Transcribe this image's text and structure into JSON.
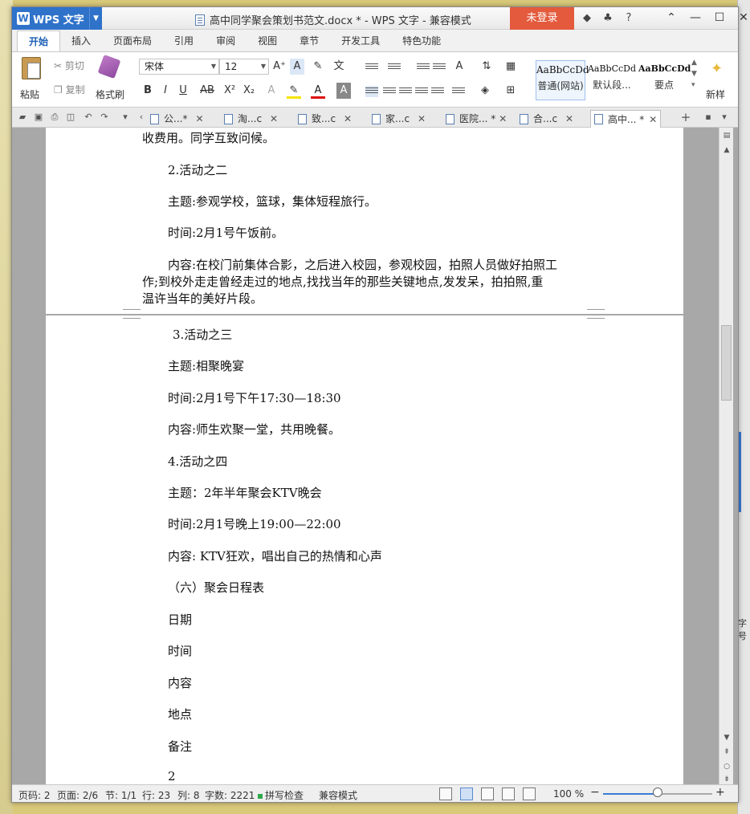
{
  "window": {
    "app_name": "WPS 文字",
    "title": "高中同学聚会策划书范文.docx * - WPS 文字 - 兼容模式",
    "login": "未登录"
  },
  "ribbon_tabs": [
    "开始",
    "插入",
    "页面布局",
    "引用",
    "审阅",
    "视图",
    "章节",
    "开发工具",
    "特色功能"
  ],
  "ribbon": {
    "paste": "粘贴",
    "cut": "剪切",
    "copy": "复制",
    "format_painter": "格式刷",
    "font_name": "宋体",
    "font_size": "12",
    "styles": [
      {
        "sample": "AaBbCcDd",
        "label": "普通(网站)"
      },
      {
        "sample": "AaBbCcDd",
        "label": "默认段..."
      },
      {
        "sample": "AaBbCcDd",
        "label": "要点"
      }
    ],
    "new_style": "新样"
  },
  "doc_tabs": [
    {
      "label": "公...*",
      "active": false
    },
    {
      "label": "淘...c",
      "active": false
    },
    {
      "label": "致...c",
      "active": false
    },
    {
      "label": "家...c",
      "active": false
    },
    {
      "label": "医院... *",
      "active": false
    },
    {
      "label": "合...c",
      "active": false
    },
    {
      "label": "高中... *",
      "active": true
    }
  ],
  "page1_lines": [
    "收费用。同学互致问候。",
    "2.活动之二",
    "主题:参观学校，篮球，集体短程旅行。",
    "时间:2月1号午饭前。",
    "内容:在校门前集体合影，之后进入校园，参观校园，拍照人员做好拍照工",
    "作;到校外走走曾经走过的地点,找找当年的那些关键地点,发发呆，拍拍照,重",
    "温许当年的美好片段。"
  ],
  "page2_lines": [
    "3.活动之三",
    "主题:相聚晚宴",
    "时间:2月1号下午17:30—18:30",
    "内容:师生欢聚一堂，共用晚餐。",
    "4.活动之四",
    "主题：2年半年聚会KTV晚会",
    "时间:2月1号晚上19:00—22:00",
    "内容: KTV狂欢，唱出自己的热情和心声",
    "（六）聚会日程表",
    "日期",
    "时间",
    "内容",
    "地点",
    "备注",
    "2"
  ],
  "statusbar": {
    "page": "页码: 2",
    "pages": "页面: 2/6",
    "section": "节: 1/1",
    "row": "行: 23",
    "col": "列: 8",
    "words": "字数: 2221",
    "spell": "拼写检查",
    "mode": "兼容模式",
    "zoom": "100 %",
    "zoom_level": 0.5
  },
  "bg_right_text": "字号",
  "colors": {
    "accent": "#2f72c9",
    "login": "#e35a3c"
  }
}
